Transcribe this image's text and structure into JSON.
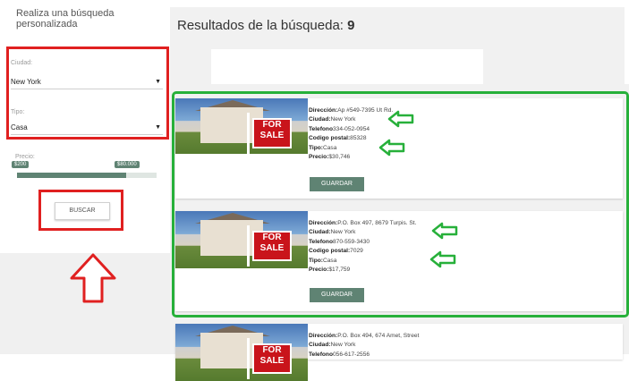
{
  "sidebar": {
    "title": "Realiza una búsqueda personalizada",
    "city_label": "Ciudad:",
    "city_value": "New York",
    "type_label": "Tipo:",
    "type_value": "Casa",
    "price_label": "Precio:",
    "price_min": "$200",
    "price_max": "$80.000",
    "price_range_fraction": 0.78,
    "search_label": "BUSCAR"
  },
  "main": {
    "results_prefix": "Resultados de la búsqueda: ",
    "results_count": "9"
  },
  "cards": [
    {
      "address_label": "Dirección:",
      "address": "Ap #549-7395 Ut Rd.",
      "city_label": "Ciudad:",
      "city": "New York",
      "phone_label": "Telefono",
      "phone": "334-052-0954",
      "zip_label": "Codigo postal:",
      "zip": "85328",
      "type_label": "Tipo:",
      "type": "Casa",
      "price_label": "Precio:",
      "price": "$30,746",
      "save_label": "GUARDAR"
    },
    {
      "address_label": "Dirección:",
      "address": "P.O. Box 497, 8679 Turpis. St.",
      "city_label": "Ciudad:",
      "city": "New York",
      "phone_label": "Telefono",
      "phone": "870-559-3430",
      "zip_label": "Codigo postal:",
      "zip": "7029",
      "type_label": "Tipo:",
      "type": "Casa",
      "price_label": "Precio:",
      "price": "$17,759",
      "save_label": "GUARDAR"
    },
    {
      "address_label": "Dirección:",
      "address": "P.O. Box 494, 674 Amet, Street",
      "city_label": "Ciudad:",
      "city": "New York",
      "phone_label": "Telefono",
      "phone": "056-617-2556"
    }
  ],
  "sale_sign_text_1": "FOR",
  "sale_sign_text_2": "SALE",
  "colors": {
    "accent": "#5f8373",
    "annotation_red": "#e02020",
    "annotation_green": "#27b03a",
    "sign_red": "#c9141b"
  }
}
